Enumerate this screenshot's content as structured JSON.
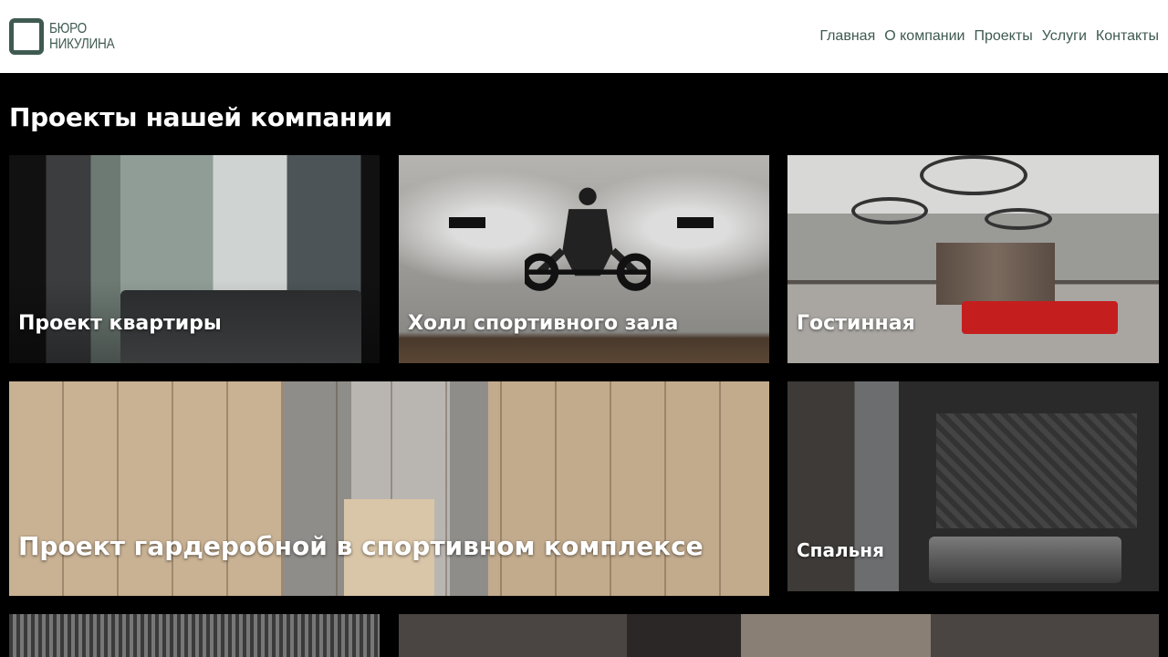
{
  "header": {
    "logo_line1": "БЮРО",
    "logo_line2": "НИКУЛИНА",
    "nav": [
      "Главная",
      "О компании",
      "Проекты",
      "Услуги",
      "Контакты"
    ]
  },
  "main": {
    "title": "Проекты нашей компании",
    "cards": [
      {
        "caption": "Проект квартиры"
      },
      {
        "caption": "Холл спортивного зала"
      },
      {
        "caption": "Гостинная"
      },
      {
        "caption": "Проект гардеробной в спортивном комплексе"
      },
      {
        "caption": "Спальня"
      }
    ]
  },
  "colors": {
    "brand": "#3f5a51",
    "background": "#000000",
    "header_bg": "#ffffff",
    "accent_red": "#c51e1e"
  }
}
